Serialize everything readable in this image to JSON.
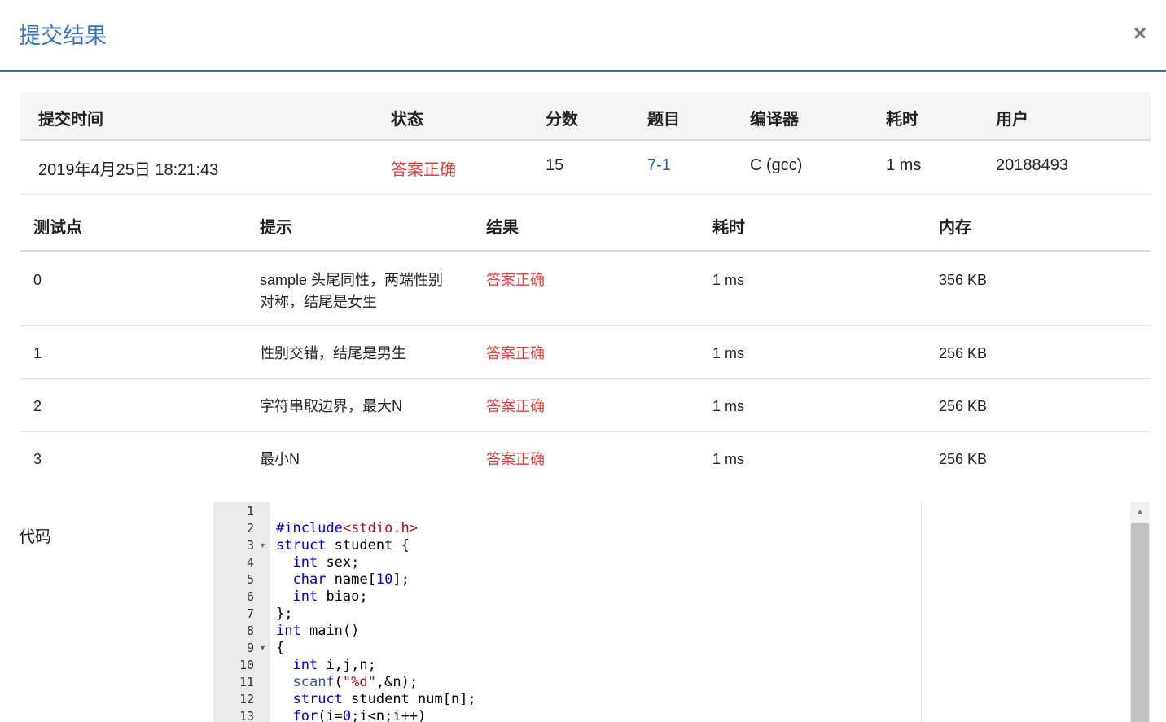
{
  "dialog": {
    "title": "提交结果",
    "close_symbol": "×"
  },
  "summary": {
    "headers": [
      "提交时间",
      "状态",
      "分数",
      "题目",
      "编译器",
      "耗时",
      "用户"
    ],
    "row": {
      "time": "2019年4月25日 18:21:43",
      "status": "答案正确",
      "score": "15",
      "problem": "7-1",
      "compiler": "C (gcc)",
      "elapsed": "1 ms",
      "user": "20188493"
    }
  },
  "tests": {
    "headers": [
      "测试点",
      "提示",
      "结果",
      "耗时",
      "内存"
    ],
    "rows": [
      {
        "id": "0",
        "hint": "sample 头尾同性，两端性别对称，结尾是女生",
        "result": "答案正确",
        "time": "1 ms",
        "memory": "356 KB"
      },
      {
        "id": "1",
        "hint": "性别交错，结尾是男生",
        "result": "答案正确",
        "time": "1 ms",
        "memory": "256 KB"
      },
      {
        "id": "2",
        "hint": "字符串取边界，最大N",
        "result": "答案正确",
        "time": "1 ms",
        "memory": "256 KB"
      },
      {
        "id": "3",
        "hint": "最小N",
        "result": "答案正确",
        "time": "1 ms",
        "memory": "256 KB"
      }
    ]
  },
  "code": {
    "label": "代码",
    "line_numbers": [
      "1",
      "2",
      "3",
      "4",
      "5",
      "6",
      "7",
      "8",
      "9",
      "10",
      "11",
      "12",
      "13"
    ],
    "fold_marker": "▼",
    "fold_lines": [
      3,
      9
    ],
    "lines": [
      "",
      "#include<stdio.h>",
      "struct student {",
      "  int sex;",
      "  char name[10];",
      "  int biao;",
      "};",
      "int main()",
      "{",
      "  int i,j,n;",
      "  scanf(\"%d\",&n);",
      "  struct student num[n];",
      "  for(i=0;i<n;i++)"
    ],
    "scroll_up_icon": "chevron-up-icon",
    "colors": {
      "keyword": "#0000cc",
      "string": "#a31515",
      "status_ok": "#d9423a",
      "title": "#3a70b6",
      "link": "#2d5c99"
    }
  }
}
